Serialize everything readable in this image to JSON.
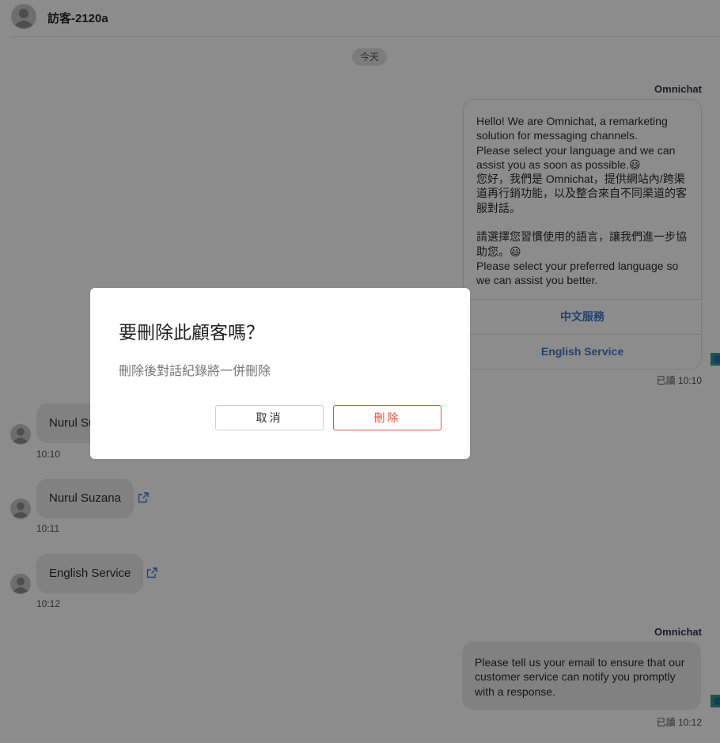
{
  "header": {
    "title": "訪客-2120a"
  },
  "chat": {
    "date_divider": "今天",
    "bot_card": {
      "sender": "Omnichat",
      "message": "Hello! We are Omnichat, a remarketing solution for messaging channels.\nPlease select your language and we can assist you as soon as possible.😃\n您好，我們是 Omnichat，提供網站內/跨渠道再行銷功能，以及整合來自不同渠道的客服對話。\n\n請選擇您習慣使用的語言，讓我們進一步協助您。😃\nPlease select your preferred language so we can assist you better.",
      "options": [
        "中文服務",
        "English Service"
      ],
      "read_status": "已讀 10:10"
    },
    "user_messages": [
      {
        "text": "Nurul Suzana",
        "time": "10:10"
      },
      {
        "text": "Nurul Suzana",
        "time": "10:11"
      },
      {
        "text": "English Service",
        "time": "10:12"
      }
    ],
    "bot_message_2": {
      "sender": "Omnichat",
      "message": "Please tell us your email to ensure that our customer service can notify you promptly with a response.",
      "read_status": "已讀 10:12"
    }
  },
  "dialog": {
    "title": "要刪除此顧客嗎？",
    "body": "刪除後對話紀錄將一併刪除",
    "cancel_label": "取消",
    "delete_label": "刪除"
  },
  "colors": {
    "link_blue": "#3f78c9",
    "danger_red": "#e0533f",
    "bubble_gray": "#ececec",
    "overlay": "rgba(0,0,0,0.45)"
  },
  "icons": {
    "avatar": "user-avatar-icon",
    "external_link": "external-link-icon"
  }
}
